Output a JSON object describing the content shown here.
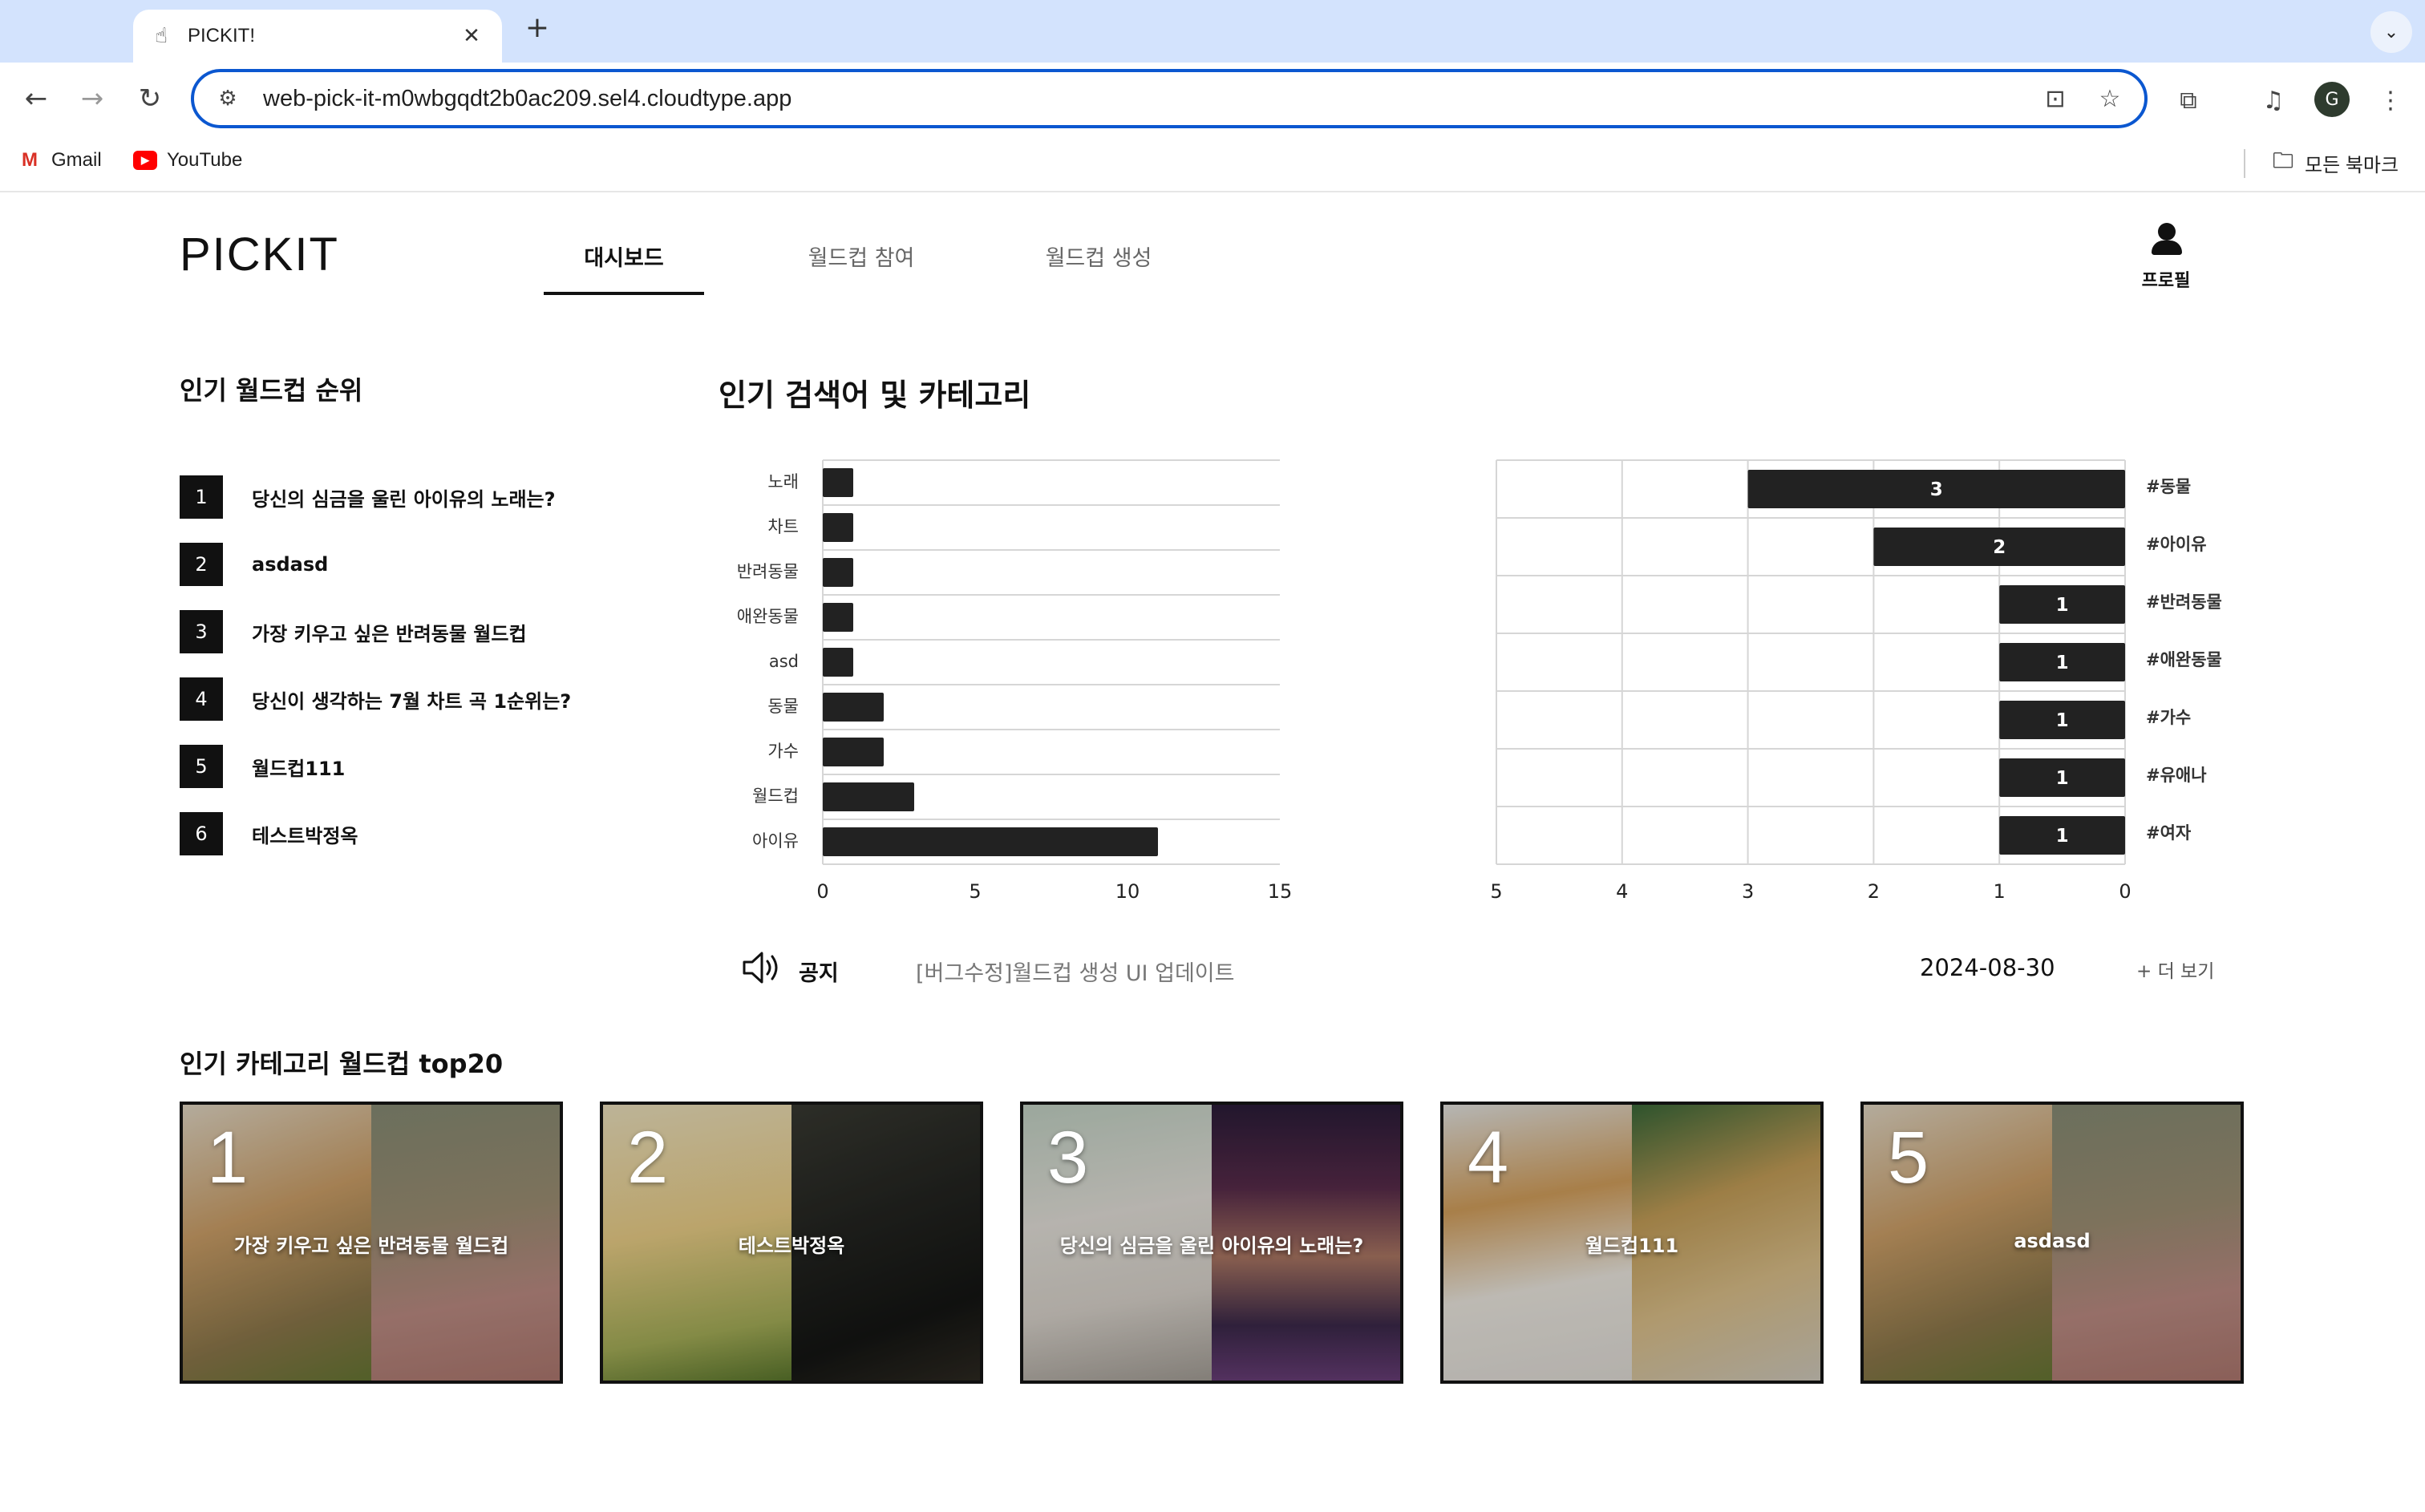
{
  "browser": {
    "tab_title": "PICKIT!",
    "url": "web-pick-it-m0wbgqdt2b0ac209.sel4.cloudtype.app",
    "bookmarks": [
      {
        "label": "Gmail",
        "icon": "gmail-icon"
      },
      {
        "label": "YouTube",
        "icon": "youtube-icon"
      }
    ],
    "all_bookmarks_label": "모든 북마크"
  },
  "header": {
    "logo": "PICKIT",
    "tabs": [
      {
        "label": "대시보드",
        "active": true
      },
      {
        "label": "월드컵 참여",
        "active": false
      },
      {
        "label": "월드컵 생성",
        "active": false
      }
    ],
    "profile_label": "프로필"
  },
  "ranking": {
    "title": "인기 월드컵 순위",
    "items": [
      {
        "rank": "1",
        "title": "당신의 심금을 울린 아이유의 노래는?"
      },
      {
        "rank": "2",
        "title": "asdasd"
      },
      {
        "rank": "3",
        "title": "가장 키우고 싶은 반려동물 월드컵"
      },
      {
        "rank": "4",
        "title": "당신이 생각하는 7월 차트 곡 1순위는?"
      },
      {
        "rank": "5",
        "title": "월드컵111"
      },
      {
        "rank": "6",
        "title": "테스트박정옥"
      }
    ]
  },
  "search_section": {
    "title": "인기 검색어 및 카테고리"
  },
  "chart_data": [
    {
      "type": "bar",
      "orientation": "horizontal",
      "categories": [
        "노래",
        "차트",
        "반려동물",
        "애완동물",
        "asd",
        "동물",
        "가수",
        "월드컵",
        "아이유"
      ],
      "values": [
        1,
        1,
        1,
        1,
        1,
        2,
        2,
        3,
        11
      ],
      "xlim": [
        0,
        15
      ],
      "xticks": [
        "0",
        "5",
        "10",
        "15"
      ],
      "grid": "horizontal",
      "bar_color": "#222222"
    },
    {
      "type": "bar",
      "orientation": "horizontal",
      "reversed_x": true,
      "categories": [
        "#동물",
        "#아이유",
        "#반려동물",
        "#애완동물",
        "#가수",
        "#유애나",
        "#여자"
      ],
      "values": [
        3,
        2,
        1,
        1,
        1,
        1,
        1
      ],
      "xlim": [
        0,
        5
      ],
      "xticks": [
        "5",
        "4",
        "3",
        "2",
        "1",
        "0"
      ],
      "grid": "both",
      "labels_on_bars": true,
      "bar_color": "#222222"
    }
  ],
  "notice": {
    "icon": "speaker-icon",
    "label": "공지",
    "text": "[버그수정]월드컵 생성 UI 업데이트",
    "date": "2024-08-30",
    "more_label": "+ 더 보기"
  },
  "top20": {
    "title": "인기 카테고리 월드컵 top20",
    "cards": [
      {
        "rank": "1",
        "title": "가장 키우고 싶은 반려동물 월드컵",
        "left_image": "corgi",
        "right_image": "turtle"
      },
      {
        "rank": "2",
        "title": "테스트박정옥",
        "left_image": "chick",
        "right_image": "beetle"
      },
      {
        "rank": "3",
        "title": "당신의 심금을 울린 아이유의 노래는?",
        "left_image": "singer",
        "right_image": "singer-window"
      },
      {
        "rank": "4",
        "title": "월드컵111",
        "left_image": "guinea-pig",
        "right_image": "gecko"
      },
      {
        "rank": "5",
        "title": "asdasd",
        "left_image": "corgi",
        "right_image": "turtle"
      }
    ]
  }
}
